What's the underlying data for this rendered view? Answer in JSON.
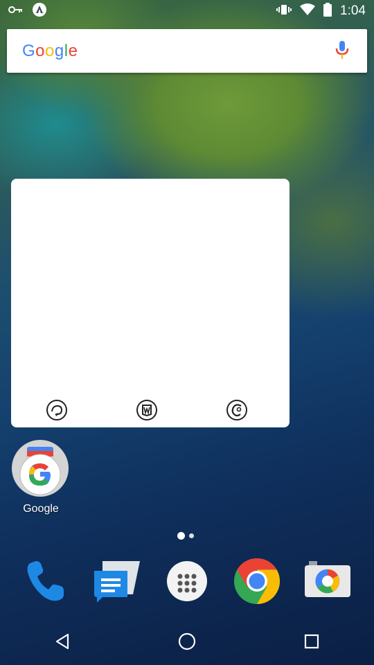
{
  "status_bar": {
    "time": "1:04",
    "icons": [
      "key-icon",
      "vpn-icon",
      "vibrate-icon",
      "wifi-icon",
      "battery-icon"
    ]
  },
  "search": {
    "logo": "Google",
    "icon": "mic-icon"
  },
  "widget": {
    "buttons": [
      "refresh-icon",
      "bookmark-icon",
      "copyright-icon"
    ]
  },
  "home": {
    "apps": [
      {
        "label": "Google",
        "icon": "google-search-icon"
      }
    ]
  },
  "page_indicator": {
    "current": 1,
    "total": 2
  },
  "dock": {
    "apps": [
      "phone-icon",
      "messages-icon",
      "app-drawer-icon",
      "chrome-icon",
      "camera-icon"
    ]
  },
  "nav_bar": {
    "buttons": [
      "back-icon",
      "home-icon",
      "recents-icon"
    ]
  },
  "colors": {
    "google_blue": "#4285F4",
    "google_red": "#EA4335",
    "google_yellow": "#FBBC05",
    "google_green": "#34A853"
  }
}
